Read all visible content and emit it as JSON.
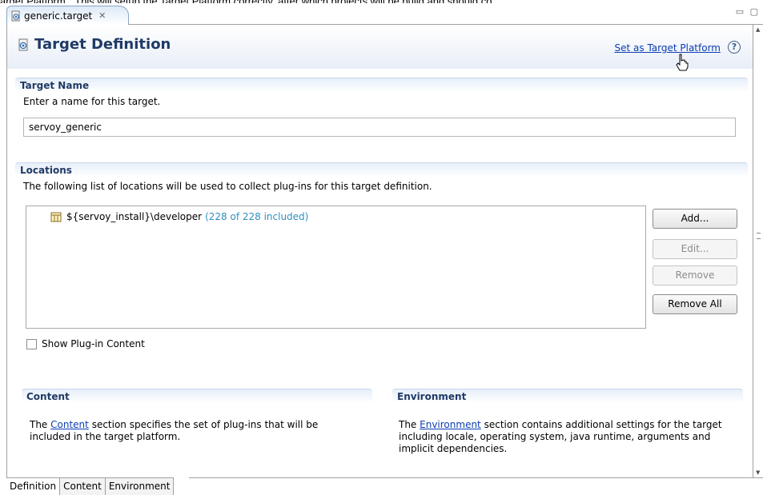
{
  "top_text": "arget Platform\". This will setup the Target Platform correctly, after which projects will be build and should co",
  "editor_tab": {
    "label": "generic.target",
    "close": "✕"
  },
  "window_controls": "▭ ▢",
  "form": {
    "title": "Target Definition",
    "set_target_link": "Set as Target Platform",
    "help": "?"
  },
  "target_name": {
    "header": "Target Name",
    "description": "Enter a name for this target.",
    "value": "servoy_generic"
  },
  "locations": {
    "header": "Locations",
    "description": "The following list of locations will be used to collect plug-ins for this target definition.",
    "items": [
      {
        "path": "${servoy_install}\\developer",
        "count": "(228 of 228 included)"
      }
    ],
    "buttons": {
      "add": "Add...",
      "edit": "Edit...",
      "remove": "Remove",
      "remove_all": "Remove All"
    },
    "show_plugin_content": "Show Plug-in Content"
  },
  "content_section": {
    "header": "Content",
    "pre": "The ",
    "link": "Content",
    "post": " section specifies the set of plug-ins that will be included in the target platform."
  },
  "environment_section": {
    "header": "Environment",
    "pre": "The ",
    "link": "Environment",
    "post": " section contains additional settings for the target including locale, operating system, java runtime, arguments and implicit dependencies."
  },
  "bottom_tabs": [
    "Definition",
    "Content",
    "Environment"
  ],
  "colors": {
    "section_header_text": "#1f3a66",
    "link": "#0b3eb3",
    "count_text": "#2f8fc0"
  }
}
